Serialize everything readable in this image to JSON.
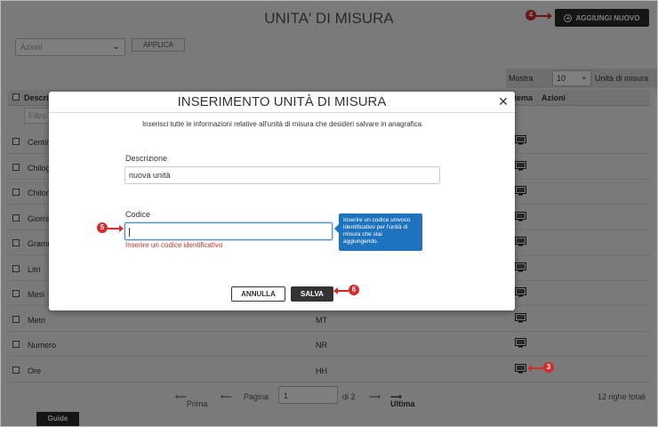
{
  "page": {
    "title": "UNITA' DI MISURA",
    "add_button": "AGGIUNGI NUOVO",
    "actions_select": "Azioni",
    "apply_button": "APPLICA",
    "show_label": "Mostra",
    "show_value": "10",
    "show_suffix": "Unità di misura",
    "filter_placeholder": "Filtro"
  },
  "table": {
    "headers": {
      "description": "Descriz",
      "system": "tema",
      "actions": "Azioni"
    },
    "rows": [
      {
        "description": "Centim",
        "code": ""
      },
      {
        "description": "Chilog",
        "code": ""
      },
      {
        "description": "Chilom",
        "code": ""
      },
      {
        "description": "Giorni",
        "code": ""
      },
      {
        "description": "Gramm",
        "code": ""
      },
      {
        "description": "Litri",
        "code": ""
      },
      {
        "description": "Mesi",
        "code": ""
      },
      {
        "description": "Metri",
        "code": "MT"
      },
      {
        "description": "Numero",
        "code": "NR"
      },
      {
        "description": "Ore",
        "code": "HH"
      }
    ]
  },
  "pagination": {
    "first": "Prima",
    "page_label": "Pagina",
    "page_value": "1",
    "of_pages": "di 2",
    "last": "Ultima",
    "total": "12 righe totali"
  },
  "guide_tab": "Guide",
  "modal": {
    "title": "INSERIMENTO UNITÀ DI MISURA",
    "subtitle": "Inserisci tutte le informazioni relative all'unità di misura che desideri salvare in anagrafica",
    "description_label": "Descrizione",
    "description_value": "nuova unità",
    "code_label": "Codice",
    "code_error": "Inserire un codice identificativo",
    "tooltip": "Inserire un codice univoco identificativo per l'unità di misura che stai aggiungendo.",
    "cancel_button": "ANNULLA",
    "save_button": "SALVA"
  },
  "markers": {
    "m3": "3",
    "m4": "4",
    "m5": "5",
    "m6": "6"
  },
  "colors": {
    "marker": "#d62b2b",
    "tooltip": "#1e73be",
    "dark_button": "#2a2a2a",
    "error": "#c0392b"
  }
}
